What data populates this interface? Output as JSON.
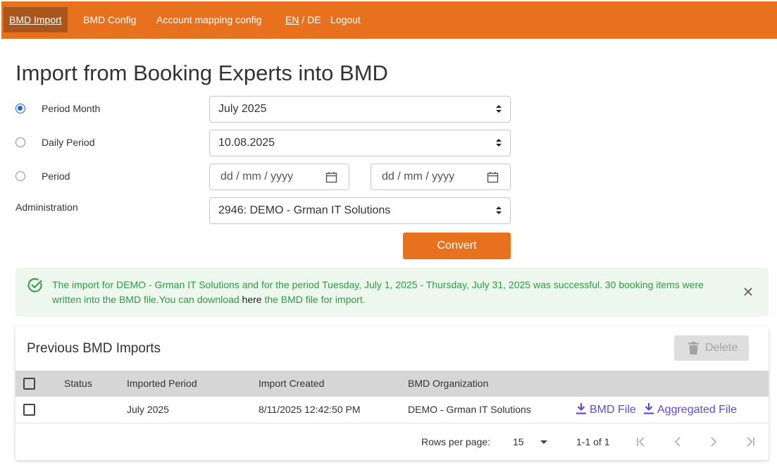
{
  "nav": {
    "items": [
      "BMD Import",
      "BMD Config",
      "Account mapping config"
    ],
    "lang_en": "EN",
    "lang_sep": " / ",
    "lang_de": "DE",
    "logout": "Logout"
  },
  "page_title": "Import from Booking Experts into BMD",
  "form": {
    "period_month": {
      "label": "Period Month",
      "value": "July 2025",
      "selected": true
    },
    "daily_period": {
      "label": "Daily Period",
      "value": "10.08.2025",
      "selected": false
    },
    "period": {
      "label": "Period",
      "from_placeholder": "dd / mm / yyyy",
      "to_placeholder": "dd / mm / yyyy",
      "selected": false
    },
    "administration": {
      "label": "Administration",
      "value": "2946: DEMO - Grman IT Solutions"
    },
    "convert_label": "Convert"
  },
  "alert": {
    "text_before": "The import for DEMO - Grman IT Solutions and for the period Tuesday, July 1, 2025 - Thursday, July 31, 2025 was successful. 30 booking items were written into the BMD file.You can download ",
    "link": "here",
    "text_after": " the BMD file for import."
  },
  "imports": {
    "title": "Previous BMD Imports",
    "delete_label": "Delete",
    "columns": [
      "Status",
      "Imported Period",
      "Import Created",
      "BMD Organization"
    ],
    "rows": [
      {
        "status": "",
        "imported_period": "July 2025",
        "import_created": "8/11/2025 12:42:50 PM",
        "organization": "DEMO - Grman IT Solutions",
        "bmd_file": "BMD File",
        "aggregated_file": "Aggregated File"
      }
    ],
    "pagination": {
      "rows_per_page_label": "Rows per page:",
      "rows_per_page": "15",
      "range": "1-1 of 1"
    }
  },
  "colors": {
    "brand_orange": "#e8711e",
    "nav_active": "#a8561c",
    "success_green": "#2e9a44",
    "success_bg": "#edf7ee",
    "link_purple": "#5f4ad8",
    "radio_blue": "#1a66d6"
  }
}
